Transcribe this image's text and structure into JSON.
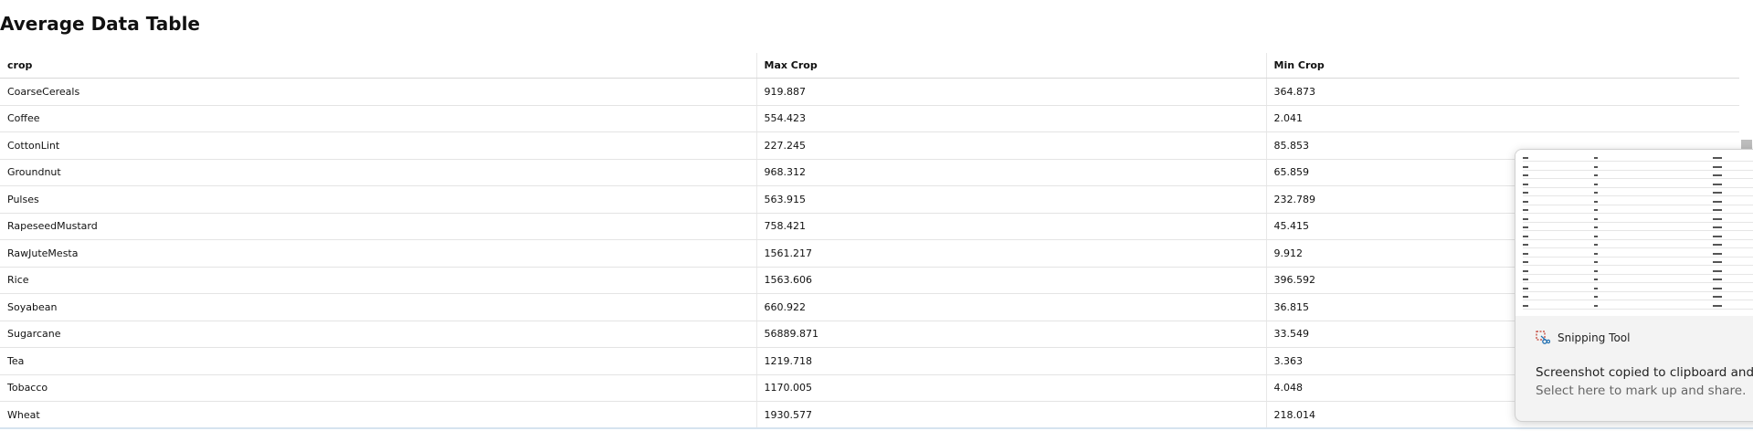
{
  "page": {
    "title": "Average Data Table"
  },
  "table": {
    "headers": [
      "crop",
      "Max Crop",
      "Min Crop"
    ],
    "rows": [
      [
        "CoarseCereals",
        "919.887",
        "364.873"
      ],
      [
        "Coffee",
        "554.423",
        "2.041"
      ],
      [
        "CottonLint",
        "227.245",
        "85.853"
      ],
      [
        "Groundnut",
        "968.312",
        "65.859"
      ],
      [
        "Pulses",
        "563.915",
        "232.789"
      ],
      [
        "RapeseedMustard",
        "758.421",
        "45.415"
      ],
      [
        "RawJuteMesta",
        "1561.217",
        "9.912"
      ],
      [
        "Rice",
        "1563.606",
        "396.592"
      ],
      [
        "Soyabean",
        "660.922",
        "36.815"
      ],
      [
        "Sugarcane",
        "56889.871",
        "33.549"
      ],
      [
        "Tea",
        "1219.718",
        "3.363"
      ],
      [
        "Tobacco",
        "1170.005",
        "4.048"
      ],
      [
        "Wheat",
        "1930.577",
        "218.014"
      ]
    ]
  },
  "notification": {
    "app_name": "Snipping Tool",
    "app_icon": "snipping-tool-icon",
    "message": "Screenshot copied to clipboard and saved",
    "sub_message": "Select here to mark up and share."
  }
}
